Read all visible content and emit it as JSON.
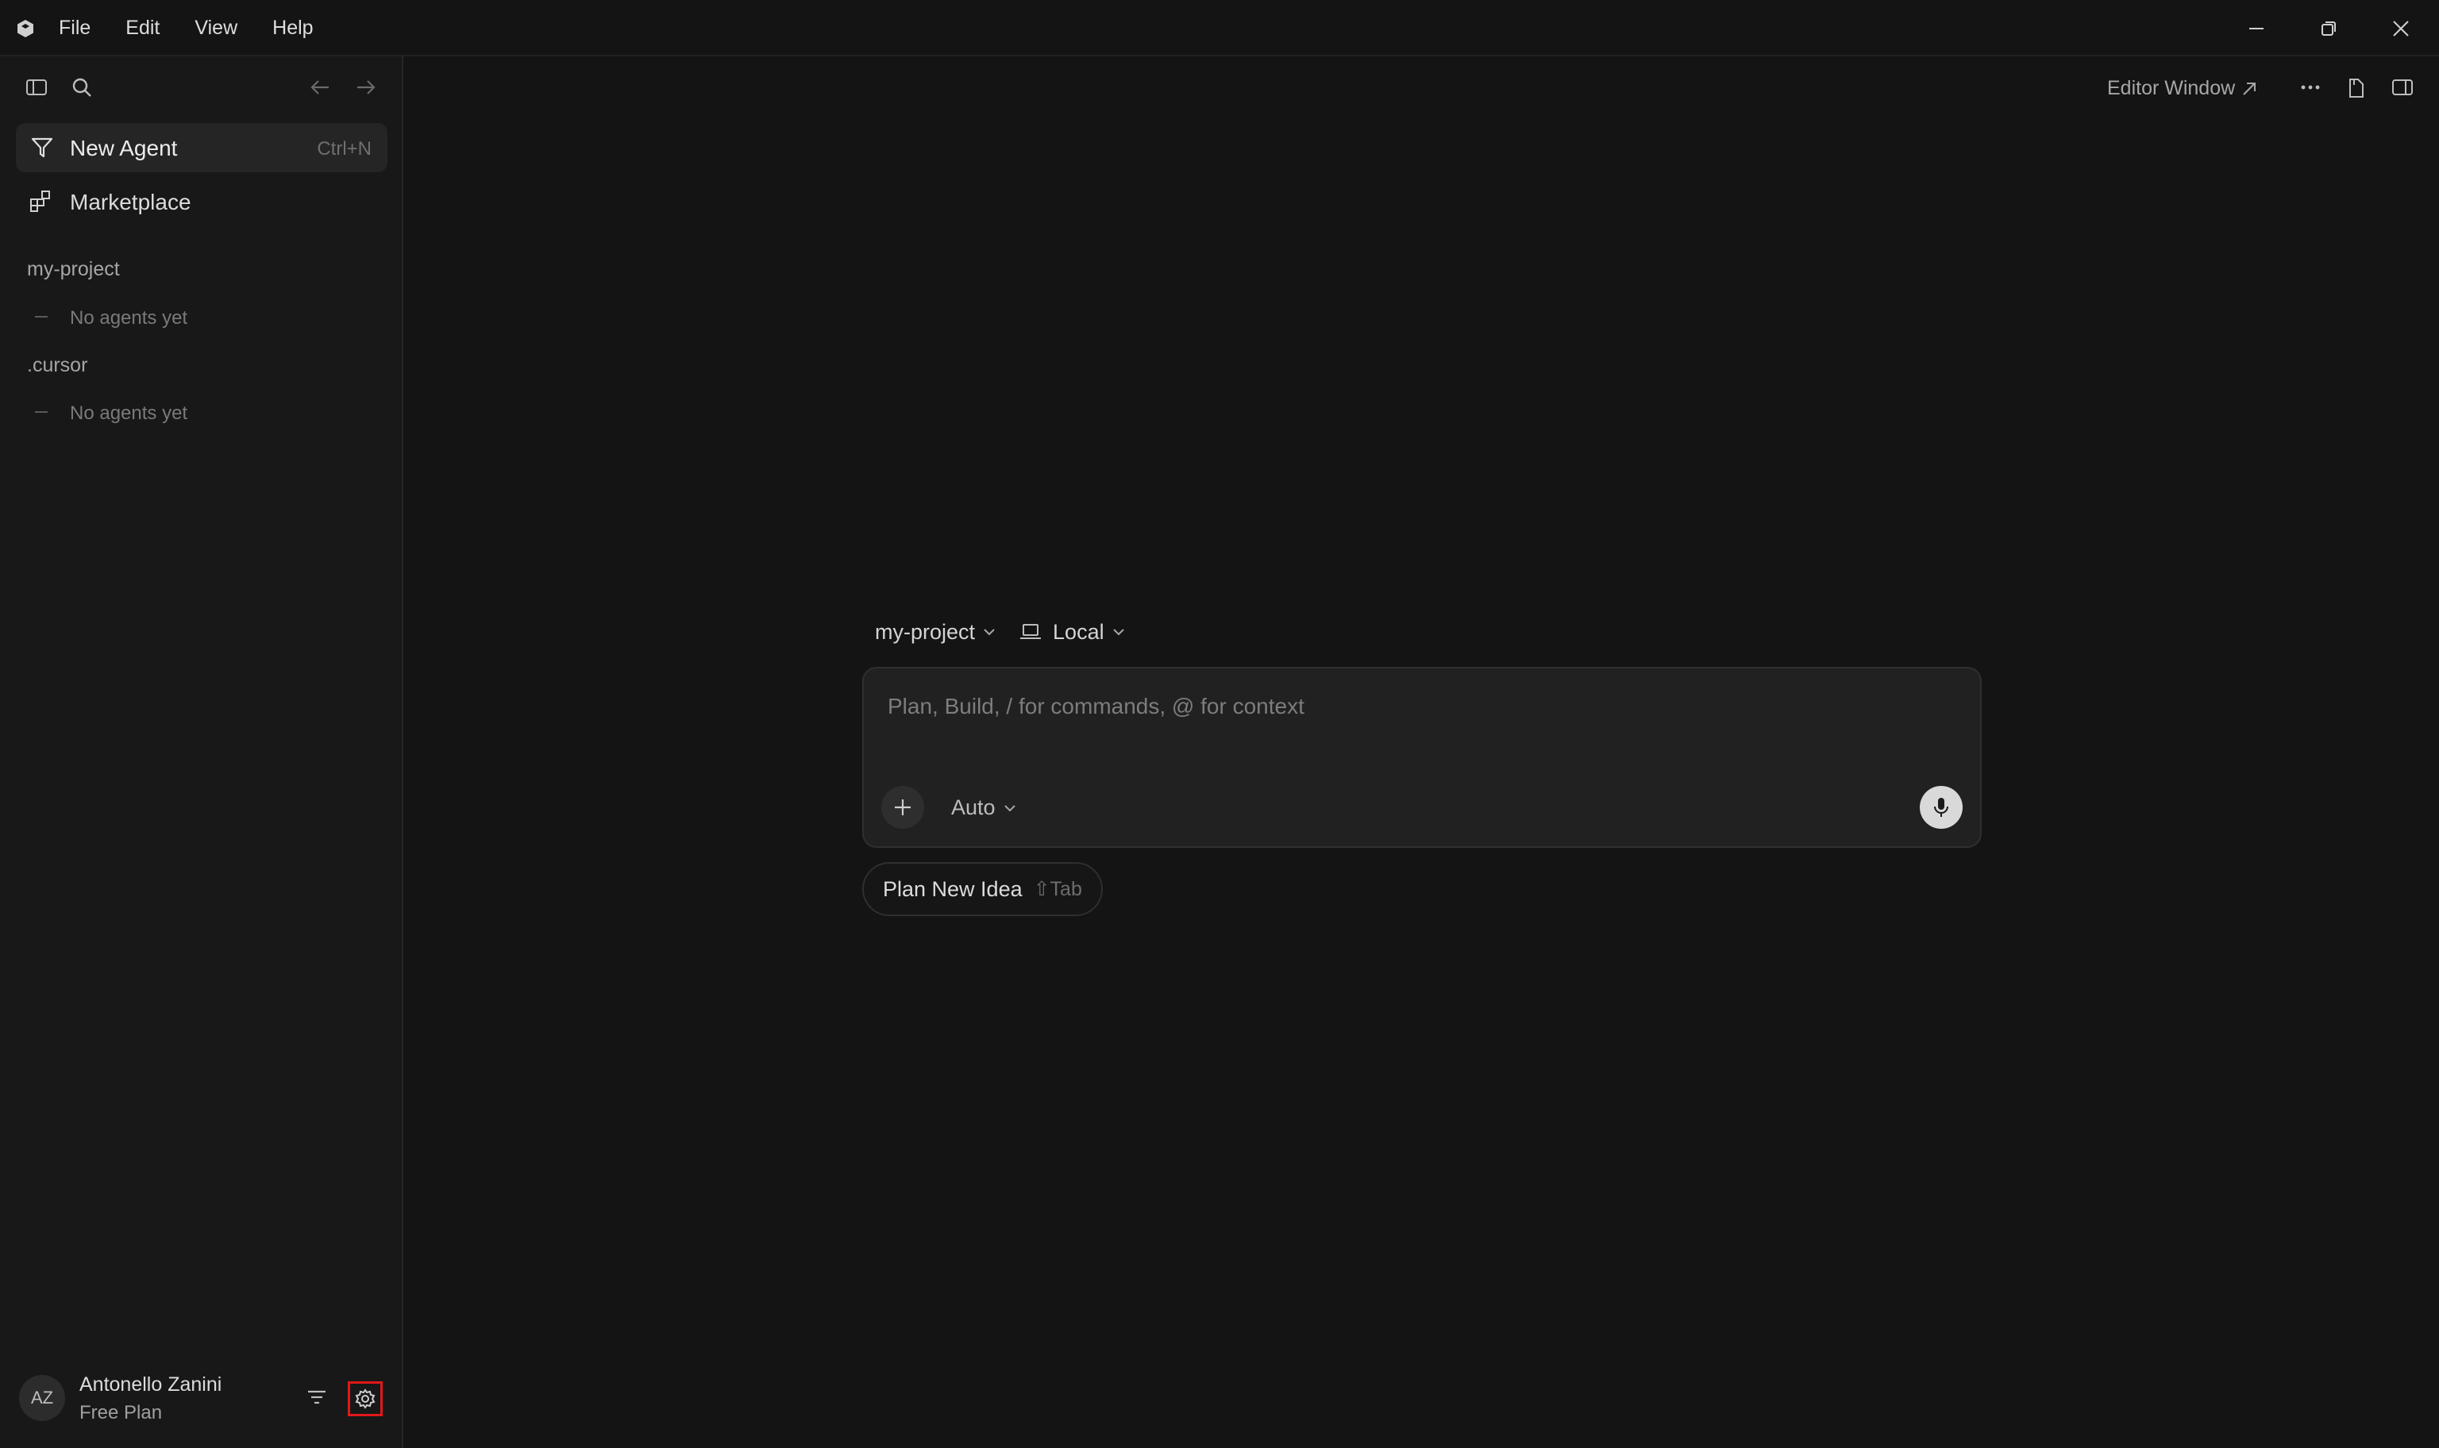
{
  "titlebar": {
    "menu": [
      "File",
      "Edit",
      "View",
      "Help"
    ]
  },
  "sidebar": {
    "new_agent_label": "New Agent",
    "new_agent_shortcut": "Ctrl+N",
    "marketplace_label": "Marketplace",
    "projects": [
      {
        "name": "my-project",
        "empty_text": "No agents yet"
      },
      {
        "name": ".cursor",
        "empty_text": "No agents yet"
      }
    ],
    "user": {
      "initials": "AZ",
      "name": "Antonello Zanini",
      "plan": "Free Plan"
    }
  },
  "main": {
    "editor_window_label": "Editor Window",
    "project_selector": "my-project",
    "location_selector": "Local",
    "composer_placeholder": "Plan, Build, / for commands, @ for context",
    "model_selector": "Auto",
    "plan_chip_label": "Plan New Idea",
    "plan_chip_hint": "⇧Tab"
  },
  "colors": {
    "background": "#141414",
    "sidebar": "#181818",
    "highlight_border": "#e31818"
  }
}
